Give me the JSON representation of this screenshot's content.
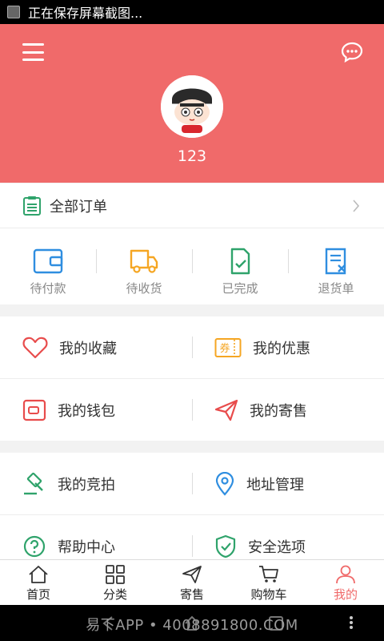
{
  "status_bar": {
    "text": "正在保存屏幕截图..."
  },
  "profile": {
    "username": "123"
  },
  "orders": {
    "title": "全部订单",
    "statuses": [
      {
        "label": "待付款",
        "icon": "wallet-icon"
      },
      {
        "label": "待收货",
        "icon": "truck-icon"
      },
      {
        "label": "已完成",
        "icon": "doc-check-icon"
      },
      {
        "label": "退货单",
        "icon": "doc-x-icon"
      }
    ]
  },
  "menu": {
    "favorites": "我的收藏",
    "coupons": "我的优惠",
    "wallet": "我的钱包",
    "consignment": "我的寄售",
    "auction": "我的竞拍",
    "address": "地址管理",
    "help": "帮助中心",
    "security": "安全选项",
    "coupon_icon_text": "券"
  },
  "tabs": [
    {
      "label": "首页",
      "icon": "home-icon"
    },
    {
      "label": "分类",
      "icon": "grid-icon"
    },
    {
      "label": "寄售",
      "icon": "send-icon"
    },
    {
      "label": "购物车",
      "icon": "cart-icon"
    },
    {
      "label": "我的",
      "icon": "user-icon"
    }
  ],
  "nav_bar": {
    "watermark": "易下APP • 4008891800.COM"
  },
  "colors": {
    "accent": "#f06a6a",
    "green": "#2fa36b",
    "blue": "#2f8ee0",
    "orange": "#f5a623",
    "red": "#e84c4c"
  }
}
